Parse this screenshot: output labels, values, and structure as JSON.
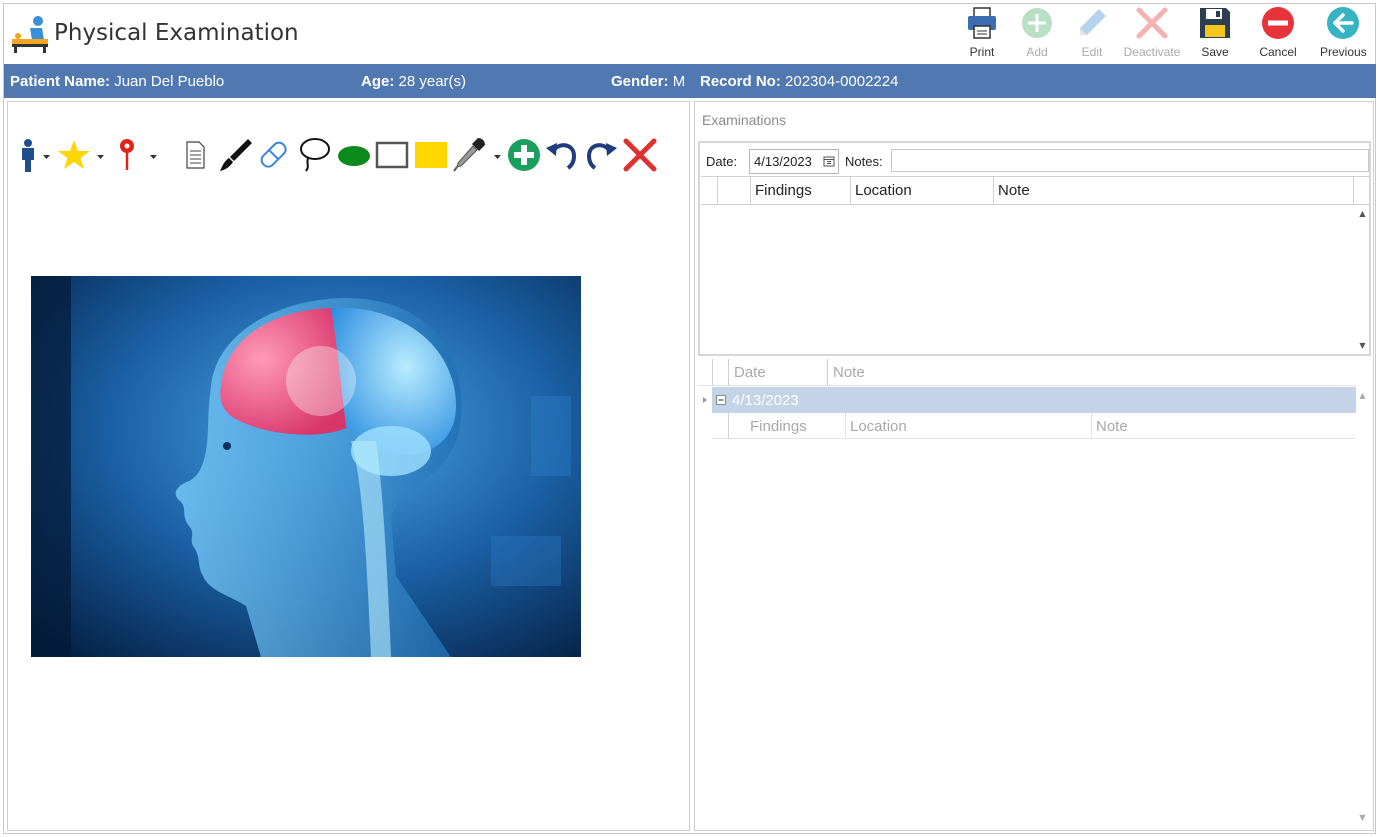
{
  "header": {
    "title": "Physical Examination",
    "buttons": [
      {
        "id": "print",
        "label": "Print",
        "icon": "printer-icon",
        "enabled": true
      },
      {
        "id": "add",
        "label": "Add",
        "icon": "plus-circle-icon",
        "enabled": false
      },
      {
        "id": "edit",
        "label": "Edit",
        "icon": "pencil-icon",
        "enabled": false
      },
      {
        "id": "deactivate",
        "label": "Deactivate",
        "icon": "x-icon",
        "enabled": false
      },
      {
        "id": "save",
        "label": "Save",
        "icon": "floppy-disk-icon",
        "enabled": true
      },
      {
        "id": "cancel",
        "label": "Cancel",
        "icon": "minus-circle-icon",
        "enabled": true
      },
      {
        "id": "previous",
        "label": "Previous",
        "icon": "arrow-left-circle-icon",
        "enabled": true
      }
    ]
  },
  "patient": {
    "name_label": "Patient Name:",
    "name": "Juan Del Pueblo",
    "age_label": "Age:",
    "age": "28 year(s)",
    "gender_label": "Gender:",
    "gender": "M",
    "record_label": "Record No:",
    "record": "202304-0002224"
  },
  "drawing_tools": [
    "person-icon",
    "star-icon",
    "map-pin-icon",
    "document-icon",
    "brush-icon",
    "eraser-icon",
    "lasso-icon",
    "ellipse-icon",
    "rectangle-icon",
    "filled-rectangle-icon",
    "eyedropper-icon",
    "add-icon",
    "undo-icon",
    "redo-icon",
    "clear-icon"
  ],
  "canvas": {
    "image_subject": "brain-anatomy-image"
  },
  "examinations": {
    "section_title": "Examinations",
    "date_label": "Date:",
    "date_value": "4/13/2023",
    "notes_label": "Notes:",
    "notes_value": "",
    "grid_columns": [
      "Findings",
      "Location",
      "Note"
    ],
    "history_columns": [
      "Date",
      "Note"
    ],
    "history_groups": [
      {
        "date": "4/13/2023",
        "sub_columns": [
          "Findings",
          "Location",
          "Note"
        ]
      }
    ]
  },
  "colors": {
    "patient_bar": "#4f79b0",
    "group_row": "#c3d3e8",
    "cancel_red": "#e8333a",
    "previous_teal": "#36b4c4"
  }
}
